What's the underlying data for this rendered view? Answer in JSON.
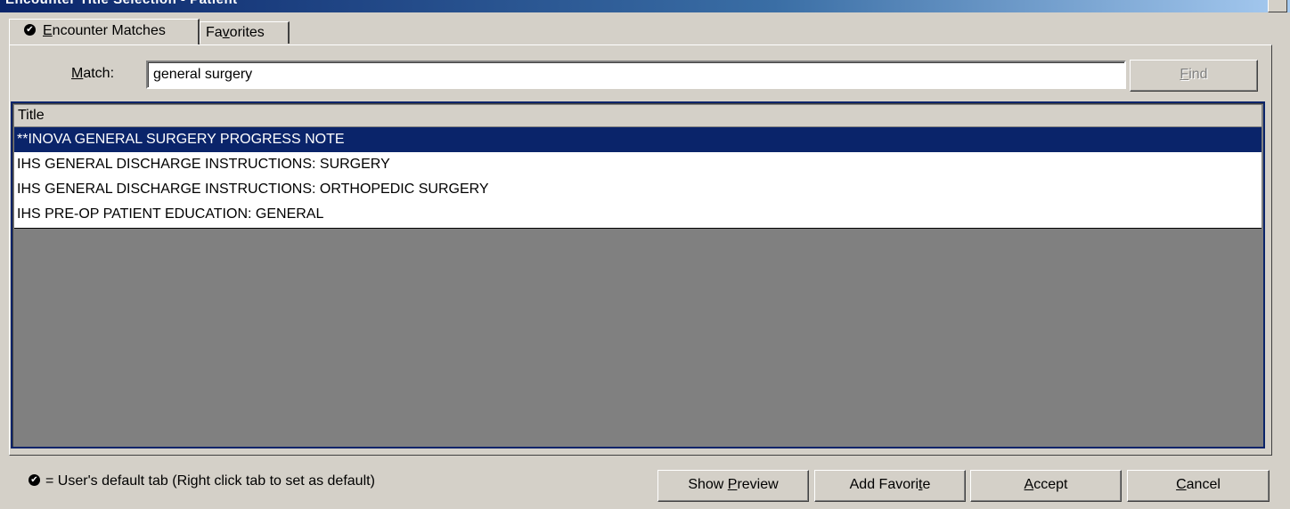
{
  "window": {
    "title": "Encounter Title Selection - Patient"
  },
  "tabs": [
    {
      "before": "",
      "mnemonic": "E",
      "after": "ncounter Matches",
      "is_default": true,
      "selected": true
    },
    {
      "before": "Fa",
      "mnemonic": "v",
      "after": "orites",
      "is_default": false,
      "selected": false
    }
  ],
  "match": {
    "label_mnemonic": "M",
    "label_rest": "atch:",
    "value": "general surgery",
    "find_mnemonic": "F",
    "find_rest": "ind",
    "find_enabled": false
  },
  "list": {
    "column_header": "Title",
    "rows": [
      {
        "title": "**INOVA GENERAL SURGERY PROGRESS NOTE",
        "selected": true
      },
      {
        "title": "IHS GENERAL DISCHARGE INSTRUCTIONS: SURGERY",
        "selected": false
      },
      {
        "title": "IHS GENERAL DISCHARGE INSTRUCTIONS: ORTHOPEDIC SURGERY",
        "selected": false
      },
      {
        "title": "IHS PRE-OP PATIENT EDUCATION: GENERAL",
        "selected": false
      }
    ]
  },
  "footer": {
    "note": "= User's default tab (Right click tab to set as default)",
    "check_icon": "check-circle-icon",
    "buttons": {
      "preview": {
        "before": "Show ",
        "mnemonic": "P",
        "after": "review"
      },
      "favorite": {
        "before": "Add Favori",
        "mnemonic": "t",
        "after": "e"
      },
      "accept": {
        "before": "",
        "mnemonic": "A",
        "after": "ccept"
      },
      "cancel": {
        "before": "",
        "mnemonic": "C",
        "after": "ancel"
      }
    }
  },
  "colors": {
    "selection": "#0a246a",
    "face": "#d4d0c8",
    "list_bg": "#808080"
  }
}
